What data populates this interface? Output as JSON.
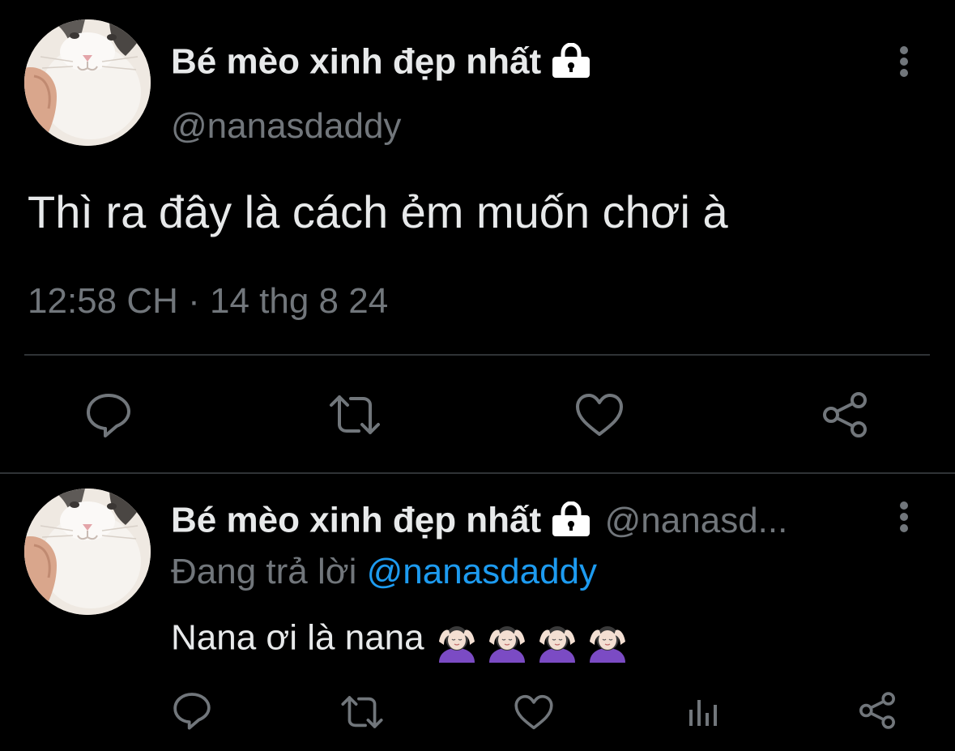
{
  "colors": {
    "background": "#000000",
    "primary_text": "#e7e9ea",
    "secondary_text": "#71767b",
    "accent": "#1d9bf0",
    "divider": "#2f3336"
  },
  "main_tweet": {
    "display_name": "Bé mèo xinh đẹp nhất",
    "handle": "@nanasdaddy",
    "text": "Thì ra đây là cách ẻm muốn chơi à",
    "timestamp": "12:58 CH · 14 thg 8 24",
    "avatar_icon": "cat-avatar",
    "lock_icon": "lock-icon",
    "more_icon": "more-vertical-icon",
    "actions": [
      "reply-icon",
      "retweet-icon",
      "like-icon",
      "share-icon"
    ]
  },
  "reply_tweet": {
    "display_name": "Bé mèo xinh đẹp nhất",
    "handle": "@nanasd...",
    "replying_to_label": "Đang trả lời",
    "replying_to_handle": "@nanasdaddy",
    "text": "Nana ơi là nana",
    "emoji_count": 4,
    "emoji_name": "person-getting-massage-emoji",
    "avatar_icon": "cat-avatar",
    "lock_icon": "lock-icon",
    "more_icon": "more-vertical-icon",
    "actions": [
      "reply-icon",
      "retweet-icon",
      "like-icon",
      "views-icon",
      "share-icon"
    ]
  }
}
